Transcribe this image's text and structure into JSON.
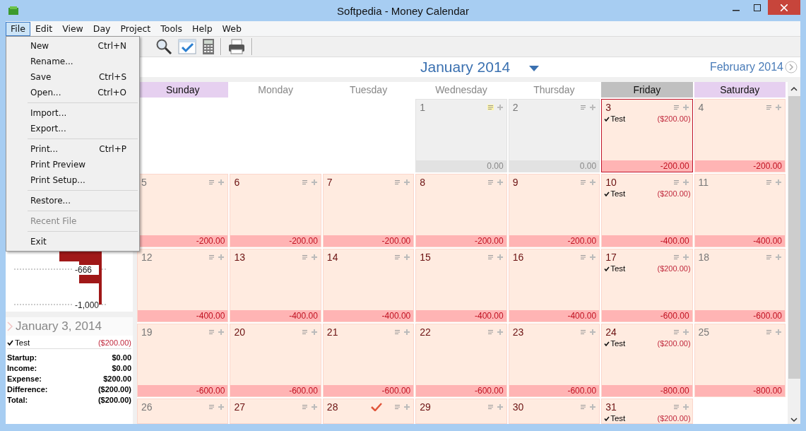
{
  "window": {
    "title": "Softpedia - Money Calendar"
  },
  "menu": [
    {
      "label": "File",
      "selected": true
    },
    {
      "label": "Edit",
      "selected": false
    },
    {
      "label": "View",
      "selected": false
    },
    {
      "label": "Day",
      "selected": false
    },
    {
      "label": "Project",
      "selected": false
    },
    {
      "label": "Tools",
      "selected": false
    },
    {
      "label": "Help",
      "selected": false
    },
    {
      "label": "Web",
      "selected": false
    }
  ],
  "file_menu": [
    {
      "kind": "item",
      "label": "New",
      "shortcut": "Ctrl+N",
      "disabled": false
    },
    {
      "kind": "item",
      "label": "Rename...",
      "disabled": false
    },
    {
      "kind": "item",
      "label": "Save",
      "shortcut": "Ctrl+S",
      "disabled": false
    },
    {
      "kind": "item",
      "label": "Open...",
      "shortcut": "Ctrl+O",
      "disabled": false
    },
    {
      "kind": "separator"
    },
    {
      "kind": "item",
      "label": "Import...",
      "disabled": false
    },
    {
      "kind": "item",
      "label": "Export...",
      "disabled": false
    },
    {
      "kind": "separator"
    },
    {
      "kind": "item",
      "label": "Print...",
      "shortcut": "Ctrl+P",
      "disabled": false
    },
    {
      "kind": "item",
      "label": "Print Preview",
      "disabled": false
    },
    {
      "kind": "item",
      "label": "Print Setup...",
      "disabled": false
    },
    {
      "kind": "separator"
    },
    {
      "kind": "item",
      "label": "Restore...",
      "disabled": false
    },
    {
      "kind": "separator"
    },
    {
      "kind": "item",
      "label": "Recent File",
      "disabled": true
    },
    {
      "kind": "separator"
    },
    {
      "kind": "item",
      "label": "Exit",
      "disabled": false
    }
  ],
  "toolbar": [
    {
      "kind": "search"
    },
    {
      "kind": "checklist"
    },
    {
      "kind": "calculator"
    },
    {
      "kind": "separator"
    },
    {
      "kind": "printer"
    },
    {
      "kind": "separator"
    }
  ],
  "balance_chart": {
    "tick_labels": [
      "-666",
      "-1,000"
    ]
  },
  "day_panel": {
    "date": "January 3, 2014",
    "entries": [
      {
        "label": "Test",
        "amount": "($200.00)",
        "checked": true
      }
    ],
    "summary": [
      {
        "label": "Startup:",
        "value": "$0.00"
      },
      {
        "label": "Income:",
        "value": "$0.00"
      },
      {
        "label": "Expense:",
        "value": "$200.00"
      },
      {
        "label": "Difference:",
        "value": "($200.00)"
      },
      {
        "label": "Total:",
        "value": "($200.00)"
      }
    ]
  },
  "calendar": {
    "month": "January 2014",
    "next_month": "February 2014",
    "weekdays": [
      {
        "label": "Sunday",
        "kind": "weekend"
      },
      {
        "label": "Monday",
        "kind": "weekday"
      },
      {
        "label": "Tuesday",
        "kind": "weekday"
      },
      {
        "label": "Wednesday",
        "kind": "weekday"
      },
      {
        "label": "Thursday",
        "kind": "weekday"
      },
      {
        "label": "Friday",
        "kind": "current"
      },
      {
        "label": "Saturday",
        "kind": "weekend"
      }
    ],
    "weeks": [
      [
        {
          "kind": "blank"
        },
        {
          "kind": "blank"
        },
        {
          "kind": "blank"
        },
        {
          "kind": "past",
          "day": "1",
          "balance": "0.00",
          "selected": false,
          "has_note": true,
          "flagged": false
        },
        {
          "kind": "past",
          "day": "2",
          "balance": "0.00",
          "selected": false,
          "has_note": false,
          "flagged": false
        },
        {
          "kind": "day",
          "day": "3",
          "balance": "-200.00",
          "selected": true,
          "has_note": false,
          "flagged": false,
          "entries": [
            {
              "label": "Test",
              "amount": "($200.00)",
              "checked": true
            }
          ]
        },
        {
          "kind": "day",
          "day": "4",
          "balance": "-200.00",
          "selected": false,
          "has_note": false,
          "flagged": false
        }
      ],
      [
        {
          "kind": "day",
          "day": "5",
          "balance": "-200.00",
          "selected": false,
          "has_note": false,
          "flagged": false
        },
        {
          "kind": "day",
          "day": "6",
          "balance": "-200.00",
          "selected": false,
          "has_note": false,
          "flagged": false
        },
        {
          "kind": "day",
          "day": "7",
          "balance": "-200.00",
          "selected": false,
          "has_note": false,
          "flagged": false
        },
        {
          "kind": "day",
          "day": "8",
          "balance": "-200.00",
          "selected": false,
          "has_note": false,
          "flagged": false
        },
        {
          "kind": "day",
          "day": "9",
          "balance": "-200.00",
          "selected": false,
          "has_note": false,
          "flagged": false
        },
        {
          "kind": "day",
          "day": "10",
          "balance": "-400.00",
          "selected": false,
          "has_note": false,
          "flagged": false,
          "entries": [
            {
              "label": "Test",
              "amount": "($200.00)",
              "checked": true
            }
          ]
        },
        {
          "kind": "day",
          "day": "11",
          "balance": "-400.00",
          "selected": false,
          "has_note": false,
          "flagged": false
        }
      ],
      [
        {
          "kind": "day",
          "day": "12",
          "balance": "-400.00",
          "selected": false,
          "has_note": false,
          "flagged": false
        },
        {
          "kind": "day",
          "day": "13",
          "balance": "-400.00",
          "selected": false,
          "has_note": false,
          "flagged": false
        },
        {
          "kind": "day",
          "day": "14",
          "balance": "-400.00",
          "selected": false,
          "has_note": false,
          "flagged": false
        },
        {
          "kind": "day",
          "day": "15",
          "balance": "-400.00",
          "selected": false,
          "has_note": false,
          "flagged": false
        },
        {
          "kind": "day",
          "day": "16",
          "balance": "-400.00",
          "selected": false,
          "has_note": false,
          "flagged": false
        },
        {
          "kind": "day",
          "day": "17",
          "balance": "-600.00",
          "selected": false,
          "has_note": false,
          "flagged": false,
          "entries": [
            {
              "label": "Test",
              "amount": "($200.00)",
              "checked": true
            }
          ]
        },
        {
          "kind": "day",
          "day": "18",
          "balance": "-600.00",
          "selected": false,
          "has_note": false,
          "flagged": false
        }
      ],
      [
        {
          "kind": "day",
          "day": "19",
          "balance": "-600.00",
          "selected": false,
          "has_note": false,
          "flagged": false
        },
        {
          "kind": "day",
          "day": "20",
          "balance": "-600.00",
          "selected": false,
          "has_note": false,
          "flagged": false
        },
        {
          "kind": "day",
          "day": "21",
          "balance": "-600.00",
          "selected": false,
          "has_note": false,
          "flagged": false
        },
        {
          "kind": "day",
          "day": "22",
          "balance": "-600.00",
          "selected": false,
          "has_note": false,
          "flagged": false
        },
        {
          "kind": "day",
          "day": "23",
          "balance": "-600.00",
          "selected": false,
          "has_note": false,
          "flagged": false
        },
        {
          "kind": "day",
          "day": "24",
          "balance": "-800.00",
          "selected": false,
          "has_note": false,
          "flagged": false,
          "entries": [
            {
              "label": "Test",
              "amount": "($200.00)",
              "checked": true
            }
          ]
        },
        {
          "kind": "day",
          "day": "25",
          "balance": "-800.00",
          "selected": false,
          "has_note": false,
          "flagged": false
        }
      ],
      [
        {
          "kind": "day",
          "day": "26",
          "selected": false,
          "has_note": false,
          "flagged": false
        },
        {
          "kind": "day",
          "day": "27",
          "selected": false,
          "has_note": false,
          "flagged": false
        },
        {
          "kind": "day",
          "day": "28",
          "selected": false,
          "has_note": false,
          "flagged": true
        },
        {
          "kind": "day",
          "day": "29",
          "selected": false,
          "has_note": false,
          "flagged": false
        },
        {
          "kind": "day",
          "day": "30",
          "selected": false,
          "has_note": false,
          "flagged": false
        },
        {
          "kind": "day",
          "day": "31",
          "selected": false,
          "has_note": false,
          "flagged": false,
          "entries": [
            {
              "label": "Test",
              "amount": "($200.00)",
              "checked": true
            }
          ]
        },
        {
          "kind": "blank"
        }
      ]
    ]
  }
}
